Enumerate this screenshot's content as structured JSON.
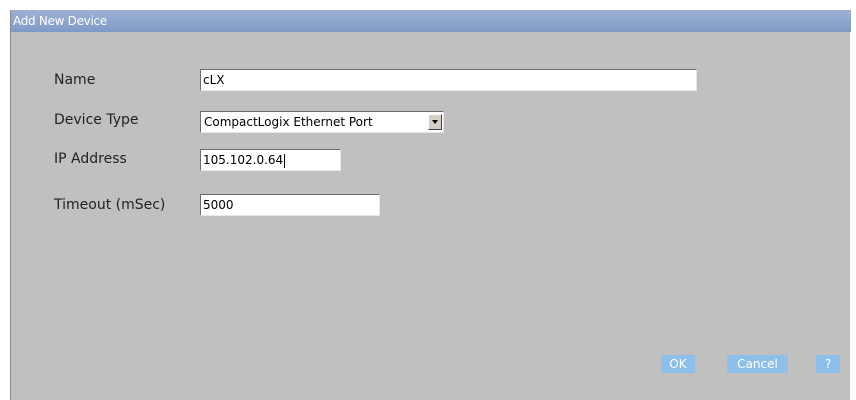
{
  "dialog": {
    "title": "Add New Device"
  },
  "form": {
    "name_label": "Name",
    "name_value": "cLX",
    "device_type_label": "Device Type",
    "device_type_value": "CompactLogix Ethernet Port",
    "ip_label": "IP Address",
    "ip_value": "105.102.0.64",
    "timeout_label": "Timeout (mSec)",
    "timeout_value": "5000"
  },
  "buttons": {
    "ok": "OK",
    "cancel": "Cancel",
    "help": "?"
  },
  "colors": {
    "titlebar": "#8aa3cc",
    "dialog_bg": "#c0c0c0",
    "button_bg": "#8cbfe9",
    "button_text": "#ffffff"
  }
}
